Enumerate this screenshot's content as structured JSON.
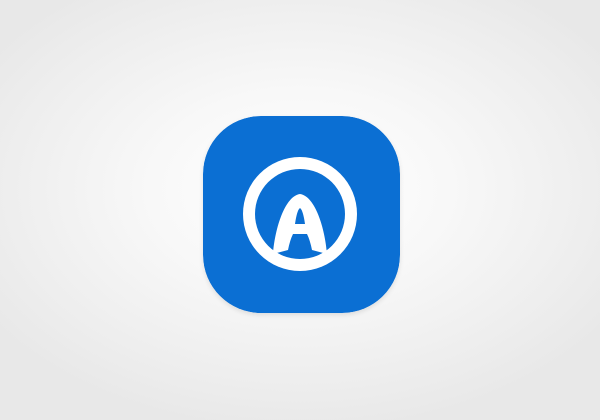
{
  "app_icon": {
    "icon": "letter-a-in-circle-icon",
    "letter": "A",
    "background_color": "#0b6fd3",
    "foreground_color": "#ffffff"
  }
}
